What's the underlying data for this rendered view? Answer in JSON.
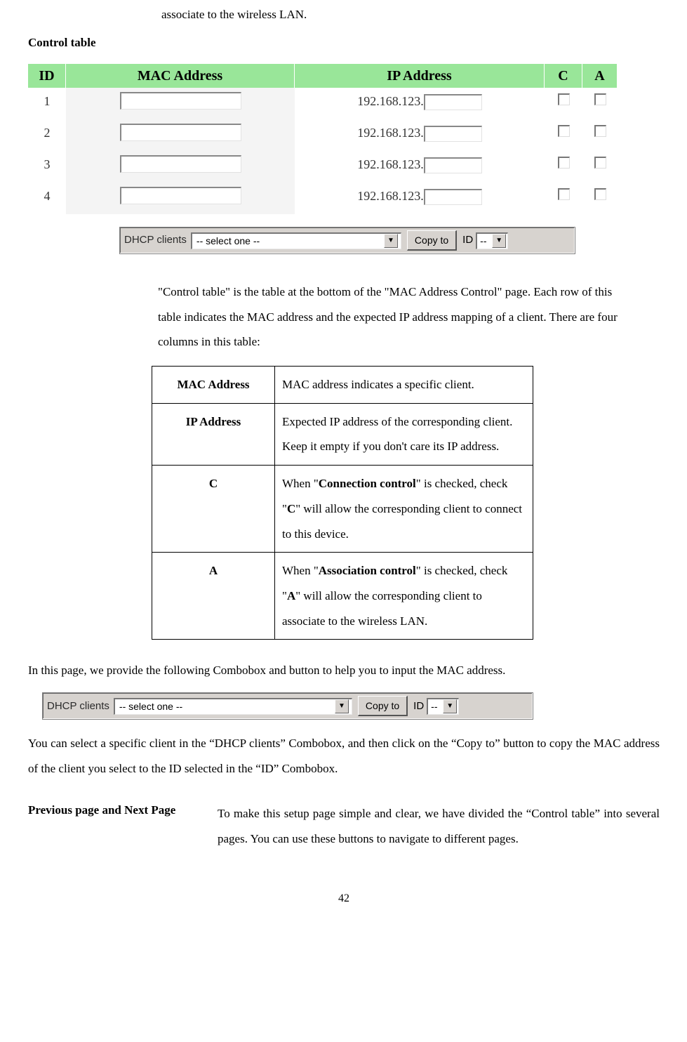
{
  "top_fragment": "associate to the wireless LAN.",
  "control_table_heading": "Control table",
  "ctl_headers": {
    "id": "ID",
    "mac": "MAC Address",
    "ip": "IP Address",
    "c": "C",
    "a": "A"
  },
  "ctl_rows": [
    {
      "id": "1",
      "ip_prefix": "192.168.123."
    },
    {
      "id": "2",
      "ip_prefix": "192.168.123."
    },
    {
      "id": "3",
      "ip_prefix": "192.168.123."
    },
    {
      "id": "4",
      "ip_prefix": "192.168.123."
    }
  ],
  "dhcp_clients_label": "DHCP clients",
  "dhcp_select_placeholder": "-- select one --",
  "copy_to_label": "Copy to",
  "id_label": "ID",
  "id_select_placeholder": "--",
  "intro_paragraph": "\"Control table\" is the table at the bottom of the \"MAC Address Control\" page. Each row of this table indicates the MAC address and the expected IP address mapping of a client. There are four columns in this table:",
  "def_rows": {
    "mac": {
      "label": "MAC Address",
      "text": "MAC address indicates a specific client."
    },
    "ip": {
      "label": "IP Address",
      "text": "Expected IP address of the corresponding client. Keep it empty if you don't care its IP address."
    },
    "c_pre": "When \"",
    "c_bold1": "Connection control",
    "c_mid": "\" is checked, check \"",
    "c_bold2": "C",
    "c_post": "\" will allow the corresponding client to connect to this device.",
    "c_label": "C",
    "a_pre": "When \"",
    "a_bold1": "Association control",
    "a_mid": "\" is checked, check \"",
    "a_bold2": "A",
    "a_post": "\" will allow the corresponding client to associate to the wireless LAN.",
    "a_label": "A"
  },
  "combobox_intro": "In this page, we provide the following Combobox and button to help you to input the MAC address.",
  "usage_para": "You can select a specific client in the “DHCP clients” Combobox, and then click on the “Copy to” button to copy the MAC address of the client you select to the ID selected in the “ID” Combobox.",
  "prev_next_label": "Previous page and Next Page",
  "prev_next_text": "To make this setup page simple and clear, we have divided the “Control table” into several pages. You can use these buttons to navigate to different pages.",
  "page_number": "42"
}
